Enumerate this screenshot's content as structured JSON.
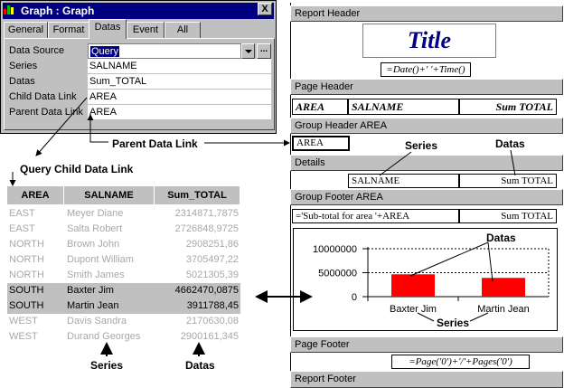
{
  "dialog": {
    "title": "Graph : Graph",
    "close_label": "X",
    "tabs": [
      "General",
      "Format",
      "Datas",
      "Event",
      "All"
    ],
    "active_tab": "Datas",
    "properties": [
      {
        "label": "Data Source",
        "value": "Query"
      },
      {
        "label": "Series",
        "value": "SALNAME"
      },
      {
        "label": "Datas",
        "value": "Sum_TOTAL"
      },
      {
        "label": "Child Data Link",
        "value": "AREA"
      },
      {
        "label": "Parent Data Link",
        "value": "AREA"
      }
    ],
    "browse_label": "..."
  },
  "annotations": {
    "parent_data_link": "Parent Data Link",
    "query_child_data_link": "Query Child Data Link",
    "series_bottom": "Series",
    "datas_bottom": "Datas",
    "series_report": "Series",
    "datas_report": "Datas",
    "datas_chart": "Datas",
    "series_chart": "Series"
  },
  "query_table": {
    "headers": [
      "AREA",
      "SALNAME",
      "Sum_TOTAL"
    ],
    "rows": [
      {
        "area": "EAST",
        "salname": "Meyer Diane",
        "total": "2314871,7875",
        "highlight": false
      },
      {
        "area": "EAST",
        "salname": "Salta Robert",
        "total": "2726848,9725",
        "highlight": false
      },
      {
        "area": "NORTH",
        "salname": "Brown John",
        "total": "2908251,86",
        "highlight": false
      },
      {
        "area": "NORTH",
        "salname": "Dupont William",
        "total": "3705497,22",
        "highlight": false
      },
      {
        "area": "NORTH",
        "salname": "Smith James",
        "total": "5021305,39",
        "highlight": false
      },
      {
        "area": "SOUTH",
        "salname": "Baxter Jim",
        "total": "4662470,0875",
        "highlight": true
      },
      {
        "area": "SOUTH",
        "salname": "Martin Jean",
        "total": "3911788,45",
        "highlight": true
      },
      {
        "area": "WEST",
        "salname": "Davis Sandra",
        "total": "2170630,08",
        "highlight": false
      },
      {
        "area": "WEST",
        "salname": "Durand Georges",
        "total": "2900161,345",
        "highlight": false
      }
    ]
  },
  "report": {
    "report_header": "Report Header",
    "title": "Title",
    "date_expr": "=Date()+' '+Time()",
    "page_header": "Page Header",
    "ph_area": "AREA",
    "ph_salname": "SALNAME",
    "ph_sum": "Sum  TOTAL",
    "group_header": "Group Header AREA",
    "gh_area": "AREA",
    "details": "Details",
    "det_salname": "SALNAME",
    "det_sum": "Sum  TOTAL",
    "group_footer": "Group Footer AREA",
    "gf_expr": "='Sub-total for area '+AREA",
    "gf_sum": "Sum  TOTAL",
    "page_footer": "Page Footer",
    "pf_expr": "=Page('0')+'/'+Pages('0')",
    "report_footer": "Report Footer"
  },
  "chart_data": {
    "type": "bar",
    "categories": [
      "Baxter Jim",
      "Martin Jean"
    ],
    "values": [
      4662470.0875,
      3911788.45
    ],
    "ylim": [
      0,
      10000000
    ],
    "yticks": [
      "10000000",
      "5000000",
      "0"
    ],
    "grid": true,
    "bar_color": "#ff0000"
  },
  "colors": {
    "titlebar": "#000080",
    "face": "#c0c0c0",
    "bar": "#ff0000",
    "title_text": "#000080"
  }
}
